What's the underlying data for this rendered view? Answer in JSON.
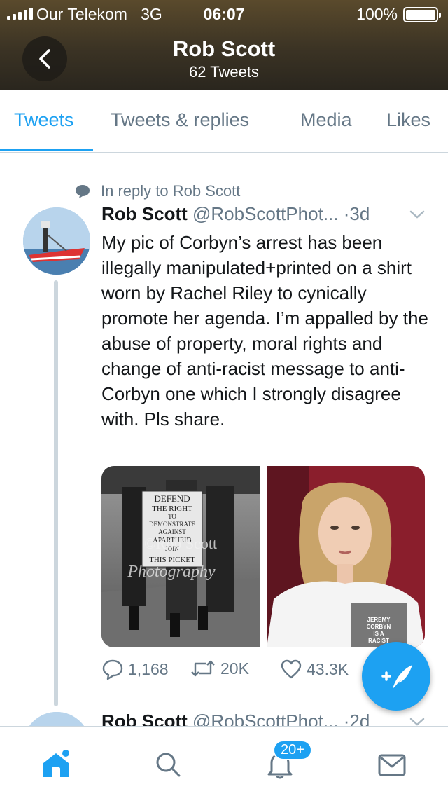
{
  "status_bar": {
    "carrier": "Our Telekom",
    "network": "3G",
    "time": "06:07",
    "battery": "100%"
  },
  "profile": {
    "name": "Rob Scott",
    "tweet_count": "62 Tweets"
  },
  "tabs": [
    {
      "label": "Tweets",
      "active": true
    },
    {
      "label": "Tweets & replies",
      "active": false
    },
    {
      "label": "Media",
      "active": false
    },
    {
      "label": "Likes",
      "active": false
    }
  ],
  "tweet": {
    "reply_context": "In reply to Rob Scott",
    "name": "Rob Scott",
    "handle": "@RobScottPhot...",
    "separator": "·",
    "time": "3d",
    "text": "My pic of Corbyn’s arrest has been illegally manipulated+printed on a shirt worn by Rachel Riley to cynically promote her agenda. I’m appalled by the abuse of property, moral rights and change of anti-racist message to anti-Corbyn one which I strongly disagree with. Pls share.",
    "photo_1": {
      "sign_lines": [
        "DEFEND",
        "THE RIGHT",
        "TO",
        "DEMONSTRATE",
        "AGAINST",
        "APARTHEID",
        "JOIN",
        "THIS PICKET"
      ],
      "watermark_lines": [
        "©Rob Scott",
        "Photography"
      ]
    },
    "photo_2": {
      "shirt_lines": [
        "JEREMY",
        "CORBYN",
        "IS A",
        "RACIST"
      ]
    },
    "replies": "1,168",
    "retweets": "20K",
    "likes": "43.3K"
  },
  "next_tweet": {
    "name": "Rob Scott",
    "handle": "@RobScottPhot...",
    "separator": "·",
    "time": "2d"
  },
  "bottom_nav": {
    "notifications_badge": "20+"
  },
  "colors": {
    "accent": "#1da1f2",
    "text": "#14171a",
    "secondary": "#657786",
    "header_bg": "#3b3324"
  }
}
